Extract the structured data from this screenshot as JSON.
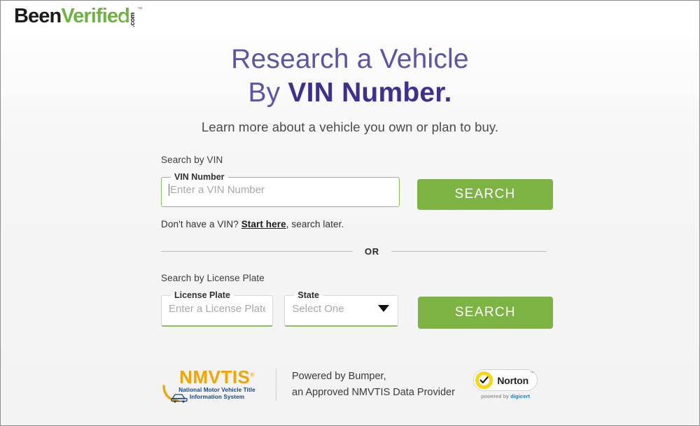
{
  "brand": {
    "logo_been": "Been",
    "logo_verified": "Verified",
    "logo_com": ".com",
    "logo_tm": "™"
  },
  "headline": {
    "line1": "Research a Vehicle",
    "line2_prefix": "By ",
    "line2_bold": "VIN Number",
    "line2_period": ".",
    "subtitle": "Learn more about a vehicle you own or plan to buy."
  },
  "vin_section": {
    "section_label": "Search by VIN",
    "field_legend": "VIN Number",
    "placeholder": "Enter a VIN Number",
    "value": "",
    "search_button": "SEARCH",
    "hint_prefix": "Don't have a VIN? ",
    "hint_link": "Start here",
    "hint_suffix": ", search later."
  },
  "divider": {
    "text": "OR"
  },
  "plate_section": {
    "section_label": "Search by License Plate",
    "plate_legend": "License Plate",
    "plate_placeholder": "Enter a License Plate",
    "plate_value": "",
    "state_legend": "State",
    "state_selected": "Select One",
    "search_button": "SEARCH"
  },
  "footer": {
    "nmvtis_title": "NMVTIS",
    "nmvtis_reg": "®",
    "nmvtis_sub_line1": "National Motor Vehicle Title",
    "nmvtis_sub_line2": "Information System",
    "powered_line1": "Powered by Bumper,",
    "powered_line2": "an Approved NMVTIS Data Provider",
    "norton_word": "Norton",
    "norton_tm": "™",
    "norton_sub_prefix": "powered by ",
    "norton_sub_brand": "digicert"
  },
  "colors": {
    "brand_green": "#6cb33f",
    "button_green": "#7cb342",
    "headline_purple": "#4b3f9e",
    "headline_bold_purple": "#3f2f91",
    "nmvtis_gold": "#f0a500",
    "nmvtis_blue": "#14477d",
    "norton_yellow": "#ffd400",
    "digicert_blue": "#0f7bc4"
  }
}
